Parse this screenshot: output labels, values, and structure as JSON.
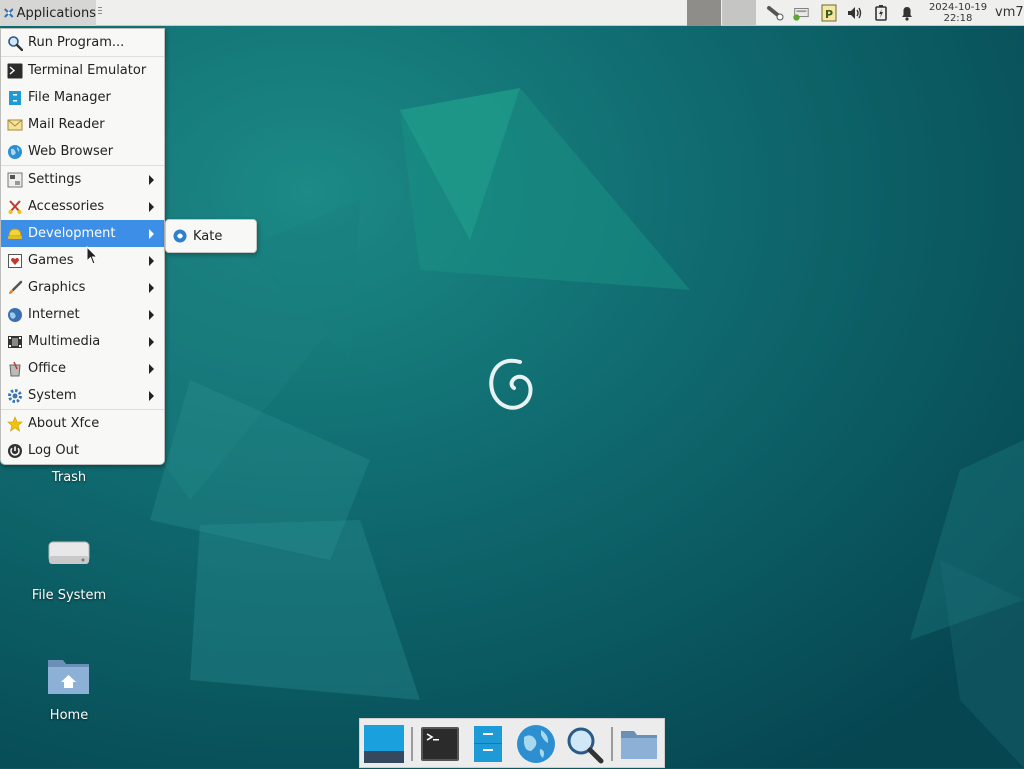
{
  "top_panel": {
    "apps_label": "Applications",
    "clock_date": "2024-10-19",
    "clock_time": "22:18",
    "hostname": "vm7",
    "tray_icons": [
      "network-wired-icon",
      "network-status-icon",
      "clipboard-parcellite-icon",
      "volume-icon",
      "battery-icon",
      "notification-bell-icon"
    ]
  },
  "menu": {
    "items": [
      {
        "label": "Run Program...",
        "icon": "search-icon"
      },
      {
        "label": "Terminal Emulator",
        "icon": "terminal-icon"
      },
      {
        "label": "File Manager",
        "icon": "file-manager-icon"
      },
      {
        "label": "Mail Reader",
        "icon": "mail-icon"
      },
      {
        "label": "Web Browser",
        "icon": "globe-icon"
      },
      {
        "label": "Settings",
        "icon": "settings-icon",
        "submenu": true
      },
      {
        "label": "Accessories",
        "icon": "accessories-icon",
        "submenu": true
      },
      {
        "label": "Development",
        "icon": "development-icon",
        "submenu": true,
        "active": true
      },
      {
        "label": "Games",
        "icon": "games-icon",
        "submenu": true
      },
      {
        "label": "Graphics",
        "icon": "graphics-icon",
        "submenu": true
      },
      {
        "label": "Internet",
        "icon": "internet-icon",
        "submenu": true
      },
      {
        "label": "Multimedia",
        "icon": "multimedia-icon",
        "submenu": true
      },
      {
        "label": "Office",
        "icon": "office-icon",
        "submenu": true
      },
      {
        "label": "System",
        "icon": "system-icon",
        "submenu": true
      },
      {
        "label": "About Xfce",
        "icon": "star-icon"
      },
      {
        "label": "Log Out",
        "icon": "logout-icon"
      }
    ],
    "submenu_items": [
      {
        "label": "Kate",
        "icon": "kate-icon"
      }
    ]
  },
  "desktop": {
    "icons": [
      {
        "label": "Trash",
        "icon": "trash-icon"
      },
      {
        "label": "File System",
        "icon": "drive-icon"
      },
      {
        "label": "Home",
        "icon": "home-folder-icon"
      }
    ]
  },
  "dock": {
    "items": [
      "show-desktop-icon",
      "terminal-icon",
      "file-manager-icon",
      "web-browser-icon",
      "app-finder-icon",
      "folder-icon"
    ]
  },
  "colors": {
    "menu_highlight": "#3d8ee6",
    "wallpaper_base": "#0b5660",
    "panel": "#efefee"
  }
}
